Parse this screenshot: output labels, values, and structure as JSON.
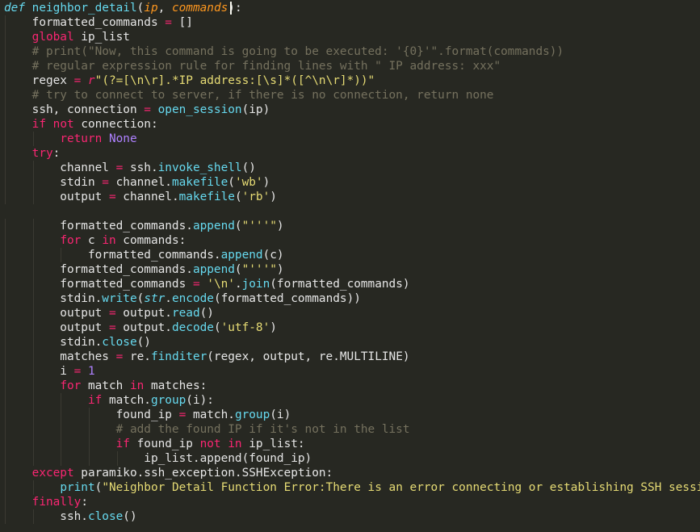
{
  "colors": {
    "background": "#272822",
    "plain": "#e6e6e6",
    "keyword": "#f92672",
    "function": "#66d9ef",
    "parameter": "#fd971f",
    "string": "#e6db74",
    "comment": "#75715e",
    "number": "#ae81ff"
  },
  "code_lines": [
    [
      [
        "storage",
        "def"
      ],
      [
        "plain",
        " "
      ],
      [
        "func",
        "neighbor_detail"
      ],
      [
        "plain",
        "("
      ],
      [
        "param",
        "ip"
      ],
      [
        "plain",
        ", "
      ],
      [
        "param",
        "commands"
      ],
      [
        "plain",
        "):"
      ]
    ],
    [
      [
        "plain",
        "    formatted_commands "
      ],
      [
        "kw",
        "="
      ],
      [
        "plain",
        " []"
      ]
    ],
    [
      [
        "plain",
        "    "
      ],
      [
        "kw",
        "global"
      ],
      [
        "plain",
        " ip_list"
      ]
    ],
    [
      [
        "plain",
        "    "
      ],
      [
        "comment",
        "# print(\"Now, this command is going to be executed: '{0}'\".format(commands))"
      ]
    ],
    [
      [
        "plain",
        "    "
      ],
      [
        "comment",
        "# regular expression rule for finding lines with \" IP address: xxx\""
      ]
    ],
    [
      [
        "plain",
        "    regex "
      ],
      [
        "kw",
        "="
      ],
      [
        "plain",
        " "
      ],
      [
        "strprefix",
        "r"
      ],
      [
        "str",
        "\"(?=[\\n\\r].*IP address:[\\s]*([^\\n\\r]*))\""
      ]
    ],
    [
      [
        "plain",
        "    "
      ],
      [
        "comment",
        "# try to connect to server, if there is no connection, return none"
      ]
    ],
    [
      [
        "plain",
        "    ssh, connection "
      ],
      [
        "kw",
        "="
      ],
      [
        "plain",
        " "
      ],
      [
        "func",
        "open_session"
      ],
      [
        "plain",
        "(ip)"
      ]
    ],
    [
      [
        "plain",
        "    "
      ],
      [
        "kw",
        "if"
      ],
      [
        "plain",
        " "
      ],
      [
        "kw",
        "not"
      ],
      [
        "plain",
        " connection:"
      ]
    ],
    [
      [
        "plain",
        "        "
      ],
      [
        "kw",
        "return"
      ],
      [
        "plain",
        " "
      ],
      [
        "const",
        "None"
      ]
    ],
    [
      [
        "plain",
        "    "
      ],
      [
        "kw",
        "try"
      ],
      [
        "plain",
        ":"
      ]
    ],
    [
      [
        "plain",
        "        channel "
      ],
      [
        "kw",
        "="
      ],
      [
        "plain",
        " ssh."
      ],
      [
        "func",
        "invoke_shell"
      ],
      [
        "plain",
        "()"
      ]
    ],
    [
      [
        "plain",
        "        stdin "
      ],
      [
        "kw",
        "="
      ],
      [
        "plain",
        " channel."
      ],
      [
        "func",
        "makefile"
      ],
      [
        "plain",
        "("
      ],
      [
        "str",
        "'wb'"
      ],
      [
        "plain",
        ")"
      ]
    ],
    [
      [
        "plain",
        "        output "
      ],
      [
        "kw",
        "="
      ],
      [
        "plain",
        " channel."
      ],
      [
        "func",
        "makefile"
      ],
      [
        "plain",
        "("
      ],
      [
        "str",
        "'rb'"
      ],
      [
        "plain",
        ")"
      ]
    ],
    [
      [
        "plain",
        ""
      ]
    ],
    [
      [
        "plain",
        "        formatted_commands."
      ],
      [
        "func",
        "append"
      ],
      [
        "plain",
        "("
      ],
      [
        "str",
        "\"'''\""
      ],
      [
        "plain",
        ")"
      ]
    ],
    [
      [
        "plain",
        "        "
      ],
      [
        "kw",
        "for"
      ],
      [
        "plain",
        " c "
      ],
      [
        "kw",
        "in"
      ],
      [
        "plain",
        " commands:"
      ]
    ],
    [
      [
        "plain",
        "            formatted_commands."
      ],
      [
        "func",
        "append"
      ],
      [
        "plain",
        "(c)"
      ]
    ],
    [
      [
        "plain",
        "        formatted_commands."
      ],
      [
        "func",
        "append"
      ],
      [
        "plain",
        "("
      ],
      [
        "str",
        "\"'''\""
      ],
      [
        "plain",
        ")"
      ]
    ],
    [
      [
        "plain",
        "        formatted_commands "
      ],
      [
        "kw",
        "="
      ],
      [
        "plain",
        " "
      ],
      [
        "str",
        "'\\n'"
      ],
      [
        "plain",
        "."
      ],
      [
        "func",
        "join"
      ],
      [
        "plain",
        "(formatted_commands)"
      ]
    ],
    [
      [
        "plain",
        "        stdin."
      ],
      [
        "func",
        "write"
      ],
      [
        "plain",
        "("
      ],
      [
        "builtin",
        "str"
      ],
      [
        "plain",
        "."
      ],
      [
        "func",
        "encode"
      ],
      [
        "plain",
        "(formatted_commands))"
      ]
    ],
    [
      [
        "plain",
        "        output "
      ],
      [
        "kw",
        "="
      ],
      [
        "plain",
        " output."
      ],
      [
        "func",
        "read"
      ],
      [
        "plain",
        "()"
      ]
    ],
    [
      [
        "plain",
        "        output "
      ],
      [
        "kw",
        "="
      ],
      [
        "plain",
        " output."
      ],
      [
        "func",
        "decode"
      ],
      [
        "plain",
        "("
      ],
      [
        "str",
        "'utf-8'"
      ],
      [
        "plain",
        ")"
      ]
    ],
    [
      [
        "plain",
        "        stdin."
      ],
      [
        "func",
        "close"
      ],
      [
        "plain",
        "()"
      ]
    ],
    [
      [
        "plain",
        "        matches "
      ],
      [
        "kw",
        "="
      ],
      [
        "plain",
        " re."
      ],
      [
        "func",
        "finditer"
      ],
      [
        "plain",
        "(regex, output, re.MULTILINE)"
      ]
    ],
    [
      [
        "plain",
        "        i "
      ],
      [
        "kw",
        "="
      ],
      [
        "plain",
        " "
      ],
      [
        "num",
        "1"
      ]
    ],
    [
      [
        "plain",
        "        "
      ],
      [
        "kw",
        "for"
      ],
      [
        "plain",
        " match "
      ],
      [
        "kw",
        "in"
      ],
      [
        "plain",
        " matches:"
      ]
    ],
    [
      [
        "plain",
        "            "
      ],
      [
        "kw",
        "if"
      ],
      [
        "plain",
        " match."
      ],
      [
        "func",
        "group"
      ],
      [
        "plain",
        "(i):"
      ]
    ],
    [
      [
        "plain",
        "                found_ip "
      ],
      [
        "kw",
        "="
      ],
      [
        "plain",
        " match."
      ],
      [
        "func",
        "group"
      ],
      [
        "plain",
        "(i)"
      ]
    ],
    [
      [
        "plain",
        "                "
      ],
      [
        "comment",
        "# add the found IP if it's not in the list"
      ]
    ],
    [
      [
        "plain",
        "                "
      ],
      [
        "kw",
        "if"
      ],
      [
        "plain",
        " found_ip "
      ],
      [
        "kw",
        "not"
      ],
      [
        "plain",
        " "
      ],
      [
        "kw",
        "in"
      ],
      [
        "plain",
        " ip_list:"
      ]
    ],
    [
      [
        "plain",
        "                    ip_list.append(found_ip)"
      ]
    ],
    [
      [
        "plain",
        "    "
      ],
      [
        "kw",
        "except"
      ],
      [
        "plain",
        " paramiko.ssh_exception.SSHException:"
      ]
    ],
    [
      [
        "plain",
        "        "
      ],
      [
        "func",
        "print"
      ],
      [
        "plain",
        "("
      ],
      [
        "str",
        "\"Neighbor Detail Function Error:There is an error connecting or establishing SSH session\""
      ],
      [
        "plain",
        ")"
      ]
    ],
    [
      [
        "plain",
        "    "
      ],
      [
        "kw",
        "finally"
      ],
      [
        "plain",
        ":"
      ]
    ],
    [
      [
        "plain",
        "        ssh."
      ],
      [
        "func",
        "close"
      ],
      [
        "plain",
        "()"
      ]
    ]
  ]
}
